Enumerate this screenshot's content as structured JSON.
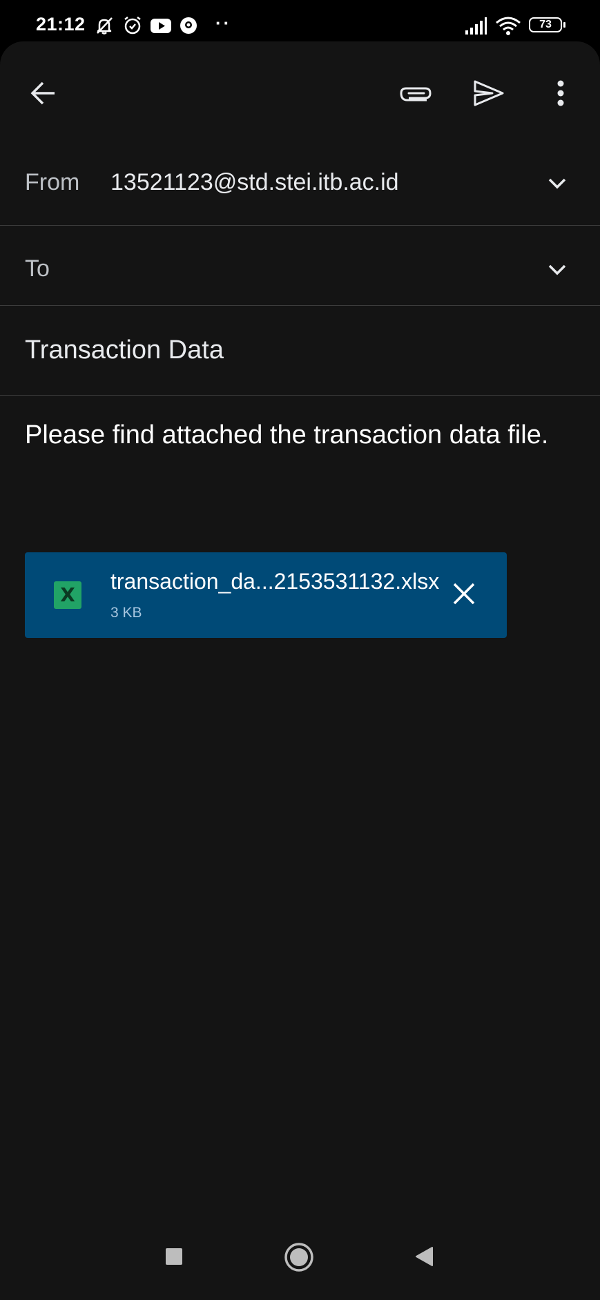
{
  "status_bar": {
    "time": "21:12",
    "left_icons": [
      "mute-bell-icon",
      "alarm-icon",
      "youtube-icon",
      "location-icon"
    ],
    "more_dots": "··",
    "right_icons": [
      "signal-icon",
      "wifi-icon"
    ],
    "battery": "73"
  },
  "toolbar": {
    "back_icon": "arrow-back-icon",
    "attach_icon": "paperclip-icon",
    "send_icon": "send-icon",
    "more_icon": "more-vert-icon"
  },
  "compose": {
    "from_label": "From",
    "from_value": "13521123@std.stei.itb.ac.id",
    "to_label": "To",
    "to_value": "",
    "subject": "Transaction Data",
    "body": "Please find attached the transaction data file."
  },
  "attachment": {
    "file_icon_letter": "X",
    "file_name": "transaction_da...2153531132.xlsx",
    "file_size": "3 KB"
  },
  "nav_bar": {
    "recent_icon": "square-recents-icon",
    "home_icon": "circle-home-icon",
    "back_icon": "triangle-back-icon"
  },
  "colors": {
    "background": "#141414",
    "attachment_bg": "#004a77",
    "excel_green": "#21a366",
    "divider": "#3c3c3c"
  }
}
